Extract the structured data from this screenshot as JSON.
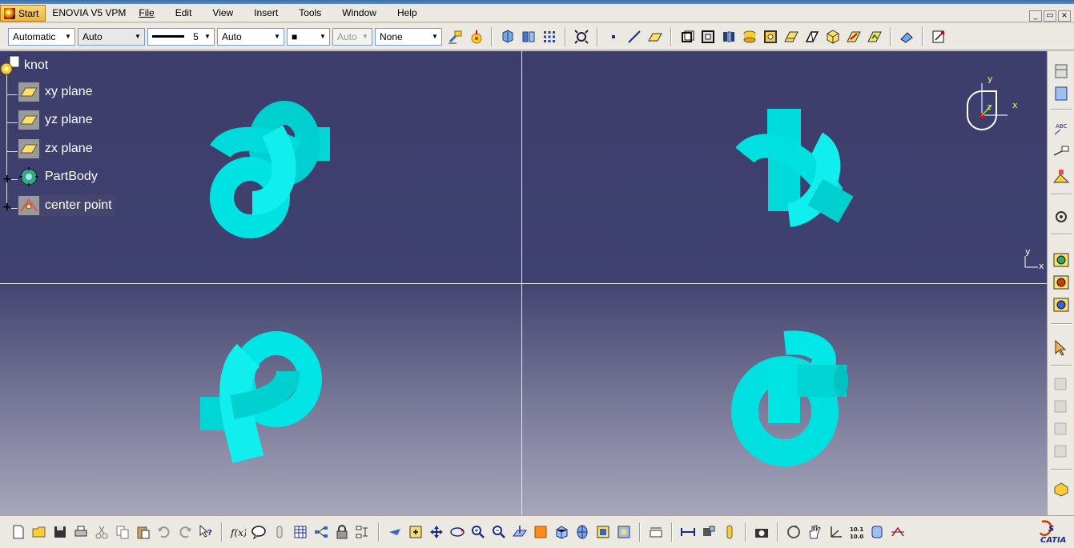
{
  "menubar": {
    "items": [
      {
        "label": "Start"
      },
      {
        "label": "ENOVIA V5 VPM"
      },
      {
        "label": "File"
      },
      {
        "label": "Edit"
      },
      {
        "label": "View"
      },
      {
        "label": "Insert"
      },
      {
        "label": "Tools"
      },
      {
        "label": "Window"
      },
      {
        "label": "Help"
      }
    ],
    "window_controls": [
      "_",
      "▭",
      "×"
    ]
  },
  "toolbar": {
    "color_combo": "Automatic",
    "transparency_combo": "Auto",
    "thickness_value": "5",
    "linetype_combo": "Auto",
    "point_symbol_combo": "■",
    "layer_combo_disabled": "Auto",
    "layer_combo": "None"
  },
  "tree": {
    "root": "knot",
    "items": [
      {
        "label": "xy plane",
        "icon": "plane-icon"
      },
      {
        "label": "yz plane",
        "icon": "plane-icon"
      },
      {
        "label": "zx plane",
        "icon": "plane-icon"
      },
      {
        "label": "PartBody",
        "icon": "partbody-icon"
      },
      {
        "label": "center point",
        "icon": "point-icon"
      }
    ]
  },
  "compass": {
    "x_label": "x",
    "y_label": "y",
    "z_label": "z"
  },
  "axis_indicator": {
    "y_label": "y",
    "x_label": "x"
  },
  "colors": {
    "knot": "#00e5e5",
    "knot_shadow": "#00a7a7",
    "viewport_top": "#3d3d6b",
    "viewport_bottom": "#a7a6ba"
  },
  "brand": "CATIA"
}
